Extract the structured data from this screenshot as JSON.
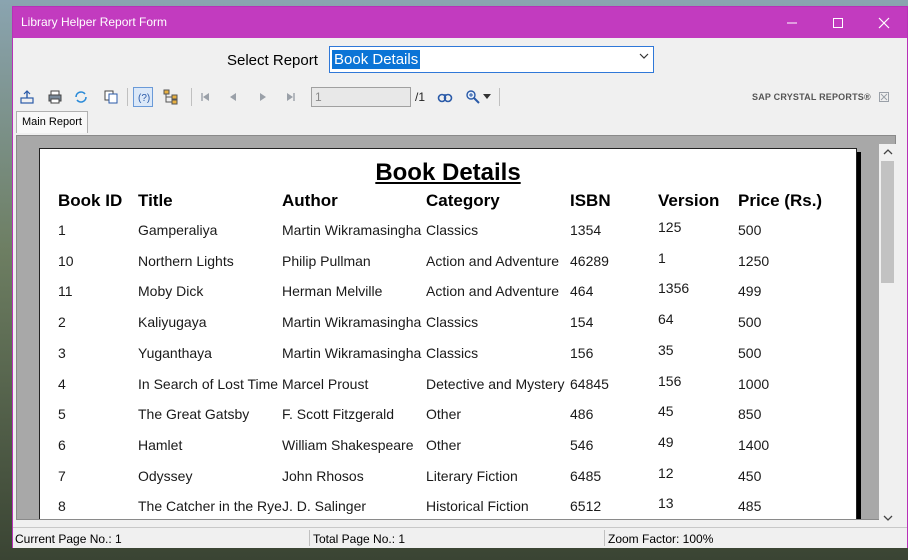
{
  "window": {
    "title": "Library Helper Report Form"
  },
  "select_report": {
    "label": "Select Report",
    "value": "Book Details"
  },
  "toolbar": {
    "page_input": "1",
    "page_total": "/1",
    "brand": "SAP CRYSTAL REPORTS®"
  },
  "tabs": [
    "Main Report"
  ],
  "report": {
    "title": "Book Details",
    "columns": [
      "Book ID",
      "Title",
      "Author",
      "Category",
      "ISBN",
      "Version",
      "Price (Rs.)"
    ],
    "rows": [
      [
        "1",
        "Gamperaliya",
        "Martin Wikramasingha",
        "Classics",
        "1354",
        "125",
        "500"
      ],
      [
        "10",
        "Northern Lights",
        "Philip Pullman",
        "Action and Adventure",
        "46289",
        "1",
        "1250"
      ],
      [
        "11",
        "Moby Dick",
        "Herman Melville",
        "Action and Adventure",
        "464",
        "1356",
        "499"
      ],
      [
        "2",
        "Kaliyugaya",
        "Martin Wikramasingha",
        "Classics",
        "154",
        "64",
        "500"
      ],
      [
        "3",
        "Yuganthaya",
        "Martin Wikramasingha",
        "Classics",
        "156",
        "35",
        "500"
      ],
      [
        "4",
        "In Search of Lost Time",
        "Marcel Proust",
        "Detective and Mystery",
        "64845",
        "156",
        "1000"
      ],
      [
        "5",
        "The Great Gatsby",
        "F. Scott Fitzgerald",
        "Other",
        "486",
        "45",
        "850"
      ],
      [
        "6",
        "Hamlet",
        "William Shakespeare",
        "Other",
        "546",
        "49",
        "1400"
      ],
      [
        "7",
        "Odyssey",
        "John Rhosos",
        "Literary Fiction",
        "6485",
        "12",
        "450"
      ],
      [
        "8",
        "The Catcher in the Rye",
        "J. D. Salinger",
        "Historical Fiction",
        "6512",
        "13",
        "485"
      ]
    ]
  },
  "status": {
    "current_page": "Current Page No.: 1",
    "total_page": "Total Page No.: 1",
    "zoom": "Zoom Factor: 100%"
  }
}
